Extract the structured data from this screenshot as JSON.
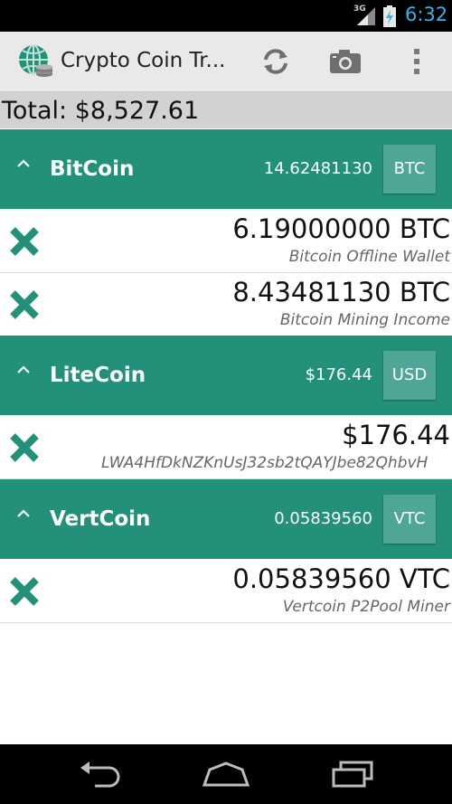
{
  "status_bar": {
    "network": "3G",
    "time": "6:32"
  },
  "action_bar": {
    "title": "Crypto Coin Tr...",
    "icons": [
      "app-logo-icon",
      "refresh-icon",
      "camera-icon",
      "overflow-menu-icon"
    ]
  },
  "total": "Total: $8,527.61",
  "groups": [
    {
      "name": "BitCoin",
      "total": "14.62481130",
      "unit": "BTC",
      "entries": [
        {
          "amount": "6.19000000 BTC",
          "label": "Bitcoin Offline Wallet"
        },
        {
          "amount": "8.43481130 BTC",
          "label": "Bitcoin Mining Income"
        }
      ]
    },
    {
      "name": "LiteCoin",
      "total": "$176.44",
      "unit": "USD",
      "entries": [
        {
          "amount": "$176.44",
          "label": "LWA4HfDkNZKnUsJ32sb2tQAYJbe82QhbvH"
        }
      ]
    },
    {
      "name": "VertCoin",
      "total": "0.05839560",
      "unit": "VTC",
      "entries": [
        {
          "amount": "0.05839560 VTC",
          "label": "Vertcoin P2Pool Miner"
        }
      ]
    }
  ],
  "colors": {
    "accent": "#23917a",
    "unit_button": "#4ea696",
    "clock": "#33b5e5"
  },
  "nav_bar": {
    "icons": [
      "back-icon",
      "home-icon",
      "recent-apps-icon"
    ]
  }
}
